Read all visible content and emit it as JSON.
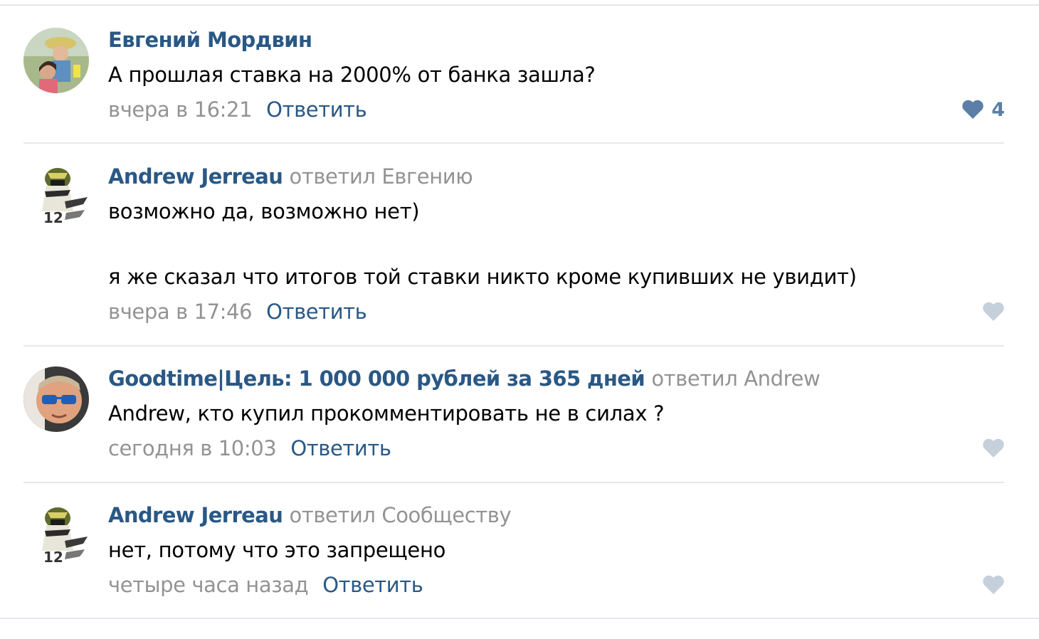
{
  "colors": {
    "link": "#2a5885",
    "muted": "#939393",
    "like_active": "#5b7fa6",
    "like_inactive": "#c5d0db"
  },
  "comments": [
    {
      "author": "Евгений Мордвин",
      "reply_to": "",
      "text": [
        "А прошлая ставка на 2000% от банка зашла?"
      ],
      "time": "вчера в 16:21",
      "reply_label": "Ответить",
      "likes": "4",
      "liked": true,
      "avatar_icon": "user-photo-icon"
    },
    {
      "author": "Andrew Jerreau",
      "reply_to": "ответил Евгению",
      "text": [
        "возможно да, возможно нет)",
        "я же сказал что итогов той ставки никто кроме купивших не увидит)"
      ],
      "time": "вчера в 17:46",
      "reply_label": "Ответить",
      "likes": "",
      "liked": false,
      "avatar_icon": "motorcycle-helmet-icon"
    },
    {
      "author": "Goodtime|Цель: 1 000 000 рублей за 365 дней",
      "reply_to": "ответил Andrew",
      "text": [
        "Andrew, кто купил прокомментировать не в силах ?"
      ],
      "time": "сегодня в 10:03",
      "reply_label": "Ответить",
      "likes": "",
      "liked": false,
      "avatar_icon": "man-sunglasses-icon"
    },
    {
      "author": "Andrew Jerreau",
      "reply_to": "ответил Сообществу",
      "text": [
        "нет, потому что это запрещено"
      ],
      "time": "четыре часа назад",
      "reply_label": "Ответить",
      "likes": "",
      "liked": false,
      "avatar_icon": "motorcycle-helmet-icon"
    }
  ]
}
